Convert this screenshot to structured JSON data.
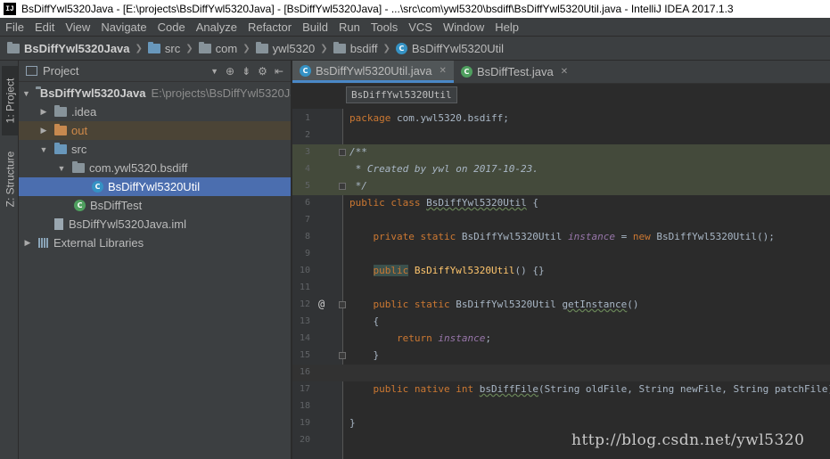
{
  "window": {
    "title": "BsDiffYwl5320Java - [E:\\projects\\BsDiffYwl5320Java] - [BsDiffYwl5320Java] - ...\\src\\com\\ywl5320\\bsdiff\\BsDiffYwl5320Util.java - IntelliJ IDEA 2017.1.3",
    "logo": "IJ"
  },
  "menu": [
    "File",
    "Edit",
    "View",
    "Navigate",
    "Code",
    "Analyze",
    "Refactor",
    "Build",
    "Run",
    "Tools",
    "VCS",
    "Window",
    "Help"
  ],
  "breadcrumb": [
    "BsDiffYwl5320Java",
    "src",
    "com",
    "ywl5320",
    "bsdiff",
    "BsDiffYwl5320Util"
  ],
  "tool_strip": {
    "project_tab": "1: Project",
    "structure_tab": "Z: Structure"
  },
  "project_panel": {
    "title": "Project",
    "tree": [
      {
        "label": "BsDiffYwl5320Java",
        "path": "E:\\projects\\BsDiffYwl5320Java"
      },
      {
        "label": ".idea"
      },
      {
        "label": "out"
      },
      {
        "label": "src"
      },
      {
        "label": "com.ywl5320.bsdiff"
      },
      {
        "label": "BsDiffYwl5320Util"
      },
      {
        "label": "BsDiffTest"
      },
      {
        "label": "BsDiffYwl5320Java.iml"
      },
      {
        "label": "External Libraries"
      }
    ]
  },
  "tabs": [
    {
      "label": "BsDiffYwl5320Util.java",
      "active": true
    },
    {
      "label": "BsDiffTest.java",
      "active": false
    }
  ],
  "editor_crumb": "BsDiffYwl5320Util",
  "editor": {
    "line_numbers": [
      "1",
      "2",
      "3",
      "4",
      "5",
      "6",
      "7",
      "8",
      "9",
      "10",
      "11",
      "12",
      "13",
      "14",
      "15",
      "16",
      "17",
      "18",
      "19",
      "20"
    ],
    "lines": {
      "l1_kw": "package",
      "l1_rest": " com.ywl5320.bsdiff;",
      "l3": "/**",
      "l4": " * Created by ywl on 2017-10-23.",
      "l5": " */",
      "l6_kw": "public class",
      "l6_name": "BsDiffYwl5320Util",
      "l6_rest": " {",
      "l8_kw": "private static",
      "l8_type": " BsDiffYwl5320Util ",
      "l8_field": "instance",
      "l8_eq": " = ",
      "l8_new": "new",
      "l8_rest": " BsDiffYwl5320Util();",
      "l10_kw": "public",
      "l10_name": "BsDiffYwl5320Util",
      "l10_rest": "() {}",
      "l12_kw": "public static",
      "l12_type": " BsDiffYwl5320Util ",
      "l12_name": "getInstance",
      "l12_rest": "()",
      "l13": "{",
      "l14_kw": "return",
      "l14_field": "instance",
      "l14_rest": ";",
      "l15": "}",
      "l17_kw": "public native int",
      "l17_name": "bsDiffFile",
      "l17_rest": "(String oldFile, String newFile, String patchFile);",
      "l19": "}"
    },
    "annotation_marker": "@"
  },
  "watermark": "http://blog.csdn.net/ywl5320",
  "colors": {
    "background": "#2b2b2b",
    "panel": "#3c3f41",
    "selection": "#4b6eaf",
    "keyword": "#cc7832",
    "comment": "#629755",
    "field": "#9876aa",
    "method_decl": "#ffc66d"
  }
}
